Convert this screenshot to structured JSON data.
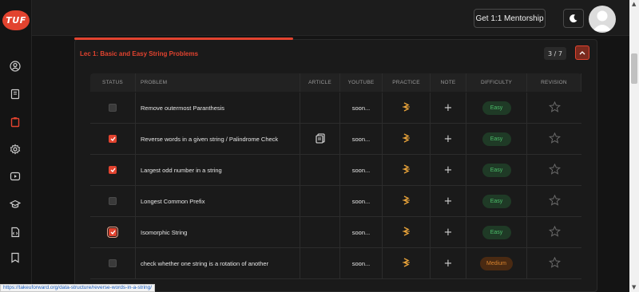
{
  "brand": {
    "logo_text": "TUF",
    "logo_color": "#e2432f"
  },
  "header": {
    "mentorship_label": "Get 1:1 Mentorship",
    "theme_icon": "moon-icon",
    "avatar_icon": "user-avatar"
  },
  "sidebar": {
    "items": [
      {
        "name": "profile",
        "icon": "user-circle-icon",
        "active": false
      },
      {
        "name": "notes",
        "icon": "notebook-icon",
        "active": false
      },
      {
        "name": "sheets",
        "icon": "clipboard-icon",
        "active": true
      },
      {
        "name": "settings",
        "icon": "gear-icon",
        "active": false
      },
      {
        "name": "videos",
        "icon": "play-icon",
        "active": false
      },
      {
        "name": "courses",
        "icon": "graduation-cap-icon",
        "active": false
      },
      {
        "name": "files",
        "icon": "code-file-icon",
        "active": false
      },
      {
        "name": "bookmarks",
        "icon": "bookmark-icon",
        "active": false
      }
    ]
  },
  "lecture": {
    "title": "Lec 1: Basic and Easy String Problems",
    "progress": "3 / 7"
  },
  "table": {
    "headers": [
      "STATUS",
      "PROBLEM",
      "ARTICLE",
      "YOUTUBE",
      "PRACTICE",
      "NOTE",
      "DIFFICULTY",
      "REVISION"
    ],
    "rows": [
      {
        "checked": false,
        "problem": "Remove outermost Paranthesis",
        "article": false,
        "youtube": "soon...",
        "difficulty": "Easy"
      },
      {
        "checked": true,
        "problem": "Reverse words in a given string / Palindrome Check",
        "article": true,
        "youtube": "soon...",
        "difficulty": "Easy"
      },
      {
        "checked": true,
        "problem": "Largest odd number in a string",
        "article": false,
        "youtube": "soon...",
        "difficulty": "Easy"
      },
      {
        "checked": false,
        "problem": "Longest Common Prefix",
        "article": false,
        "youtube": "soon...",
        "difficulty": "Easy"
      },
      {
        "checked": true,
        "problem": "Isomorphic String",
        "article": false,
        "youtube": "soon...",
        "difficulty": "Easy",
        "focused": true
      },
      {
        "checked": false,
        "problem": "check whether one string is a rotation of another",
        "article": false,
        "youtube": "soon...",
        "difficulty": "Medium"
      }
    ]
  },
  "statusbar": {
    "url": "https://takeuforward.org/data-structure/reverse-words-in-a-string/"
  },
  "colors": {
    "accent": "#e2432f",
    "easy": "#4cbf6a",
    "medium": "#d8832e",
    "practice": "#e8a33a"
  }
}
